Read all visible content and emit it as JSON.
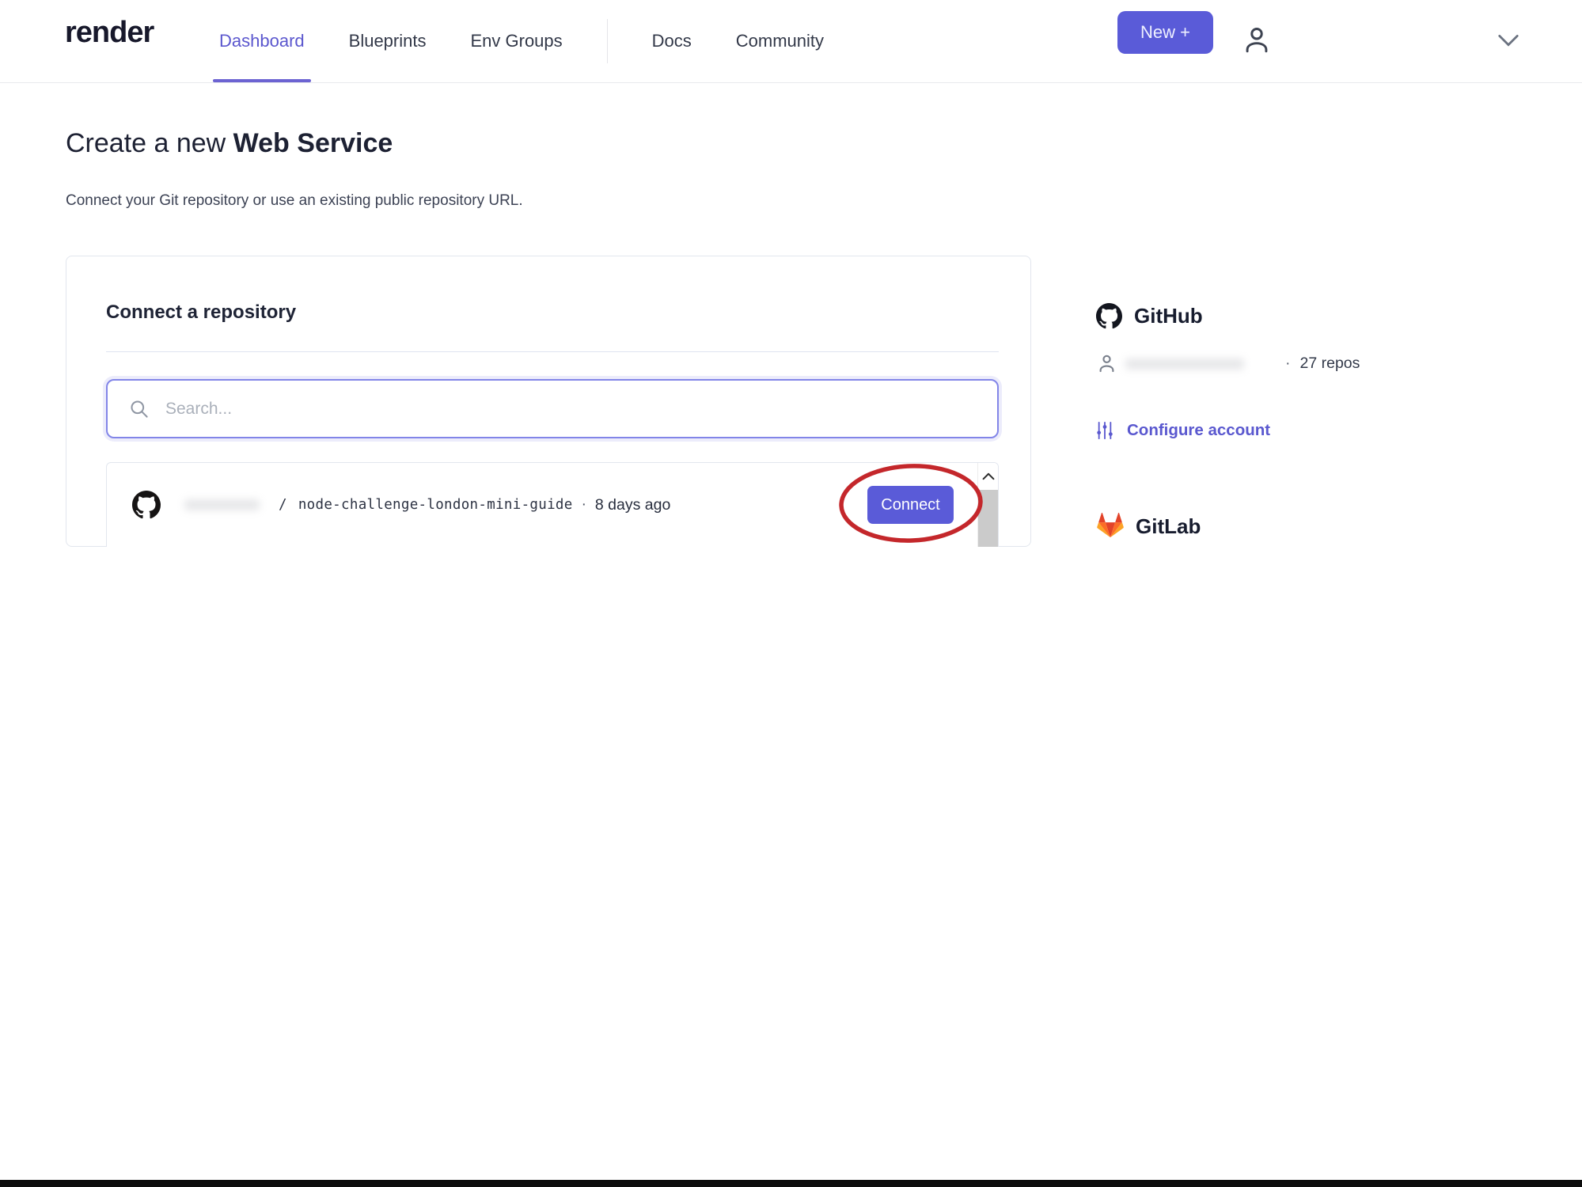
{
  "header": {
    "logo": "render",
    "nav": [
      {
        "label": "Dashboard",
        "active": true
      },
      {
        "label": "Blueprints",
        "active": false
      },
      {
        "label": "Env Groups",
        "active": false
      },
      {
        "label": "Docs",
        "active": false
      },
      {
        "label": "Community",
        "active": false
      }
    ],
    "new_button": "New +"
  },
  "page": {
    "title_regular": "Create a new ",
    "title_bold": "Web Service",
    "subtitle": "Connect your Git repository or use an existing public repository URL."
  },
  "card": {
    "heading": "Connect a repository",
    "search_placeholder": "Search...",
    "repo": {
      "separator": "/",
      "name": "node-challenge-london-mini-guide",
      "dot": "·",
      "updated": "8 days ago",
      "connect_label": "Connect"
    }
  },
  "sidebar": {
    "github": {
      "title": "GitHub",
      "dot": "·",
      "repos_count": "27 repos",
      "configure_label": "Configure account"
    },
    "gitlab": {
      "title": "GitLab"
    }
  },
  "colors": {
    "accent": "#5a5bd8",
    "annotation_red": "#c4272b",
    "gitlab_orange": "#e24329"
  }
}
